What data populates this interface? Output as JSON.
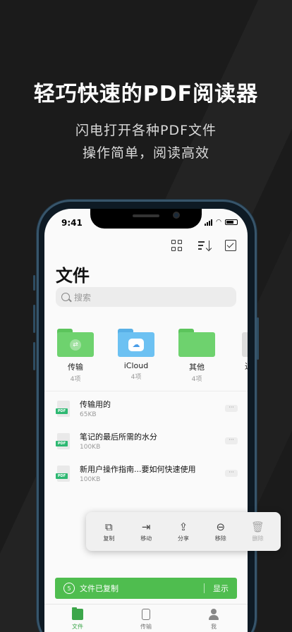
{
  "promo": {
    "headline": "轻巧快速的PDF阅读器",
    "sub1": "闪电打开各种PDF文件",
    "sub2": "操作简单，阅读高效"
  },
  "status_bar": {
    "time": "9:41"
  },
  "toolbar": {
    "icons": [
      "grid-view-icon",
      "sort-icon",
      "select-check-icon"
    ]
  },
  "page": {
    "title": "文件",
    "search_placeholder": "搜索"
  },
  "folders": [
    {
      "name": "传输",
      "count": "4项",
      "color": "#6ed26e",
      "badge": "⇄"
    },
    {
      "name": "iCloud",
      "count": "4项",
      "color": "#6cc1f2",
      "badge": "☁"
    },
    {
      "name": "其他",
      "count": "4项",
      "color": "#6ed26e",
      "badge": ""
    }
  ],
  "folder_partial_label": "近",
  "files": [
    {
      "name": "传输用的",
      "size": "65KB",
      "type": "PDF"
    },
    {
      "name": "笔记的最后所需的水分",
      "size": "100KB",
      "type": "PDF"
    },
    {
      "name": "新用户操作指南...要如何快速使用",
      "size": "100KB",
      "type": "PDF"
    }
  ],
  "more_label": "···",
  "action_bar": [
    {
      "label": "复制",
      "glyph": "⧉"
    },
    {
      "label": "移动",
      "glyph": "⇥"
    },
    {
      "label": "分享",
      "glyph": "⇪"
    },
    {
      "label": "移除",
      "glyph": "⊖"
    },
    {
      "label": "删除",
      "glyph": "🗑"
    }
  ],
  "toast": {
    "count": "5",
    "message": "文件已复制",
    "action": "显示"
  },
  "tabs": [
    {
      "label": "文件",
      "active": true
    },
    {
      "label": "传输",
      "active": false
    },
    {
      "label": "我",
      "active": false
    }
  ],
  "colors": {
    "accent_green": "#4fbd4f",
    "pdf_green": "#2eb872",
    "phone_frame": "#37556b"
  }
}
